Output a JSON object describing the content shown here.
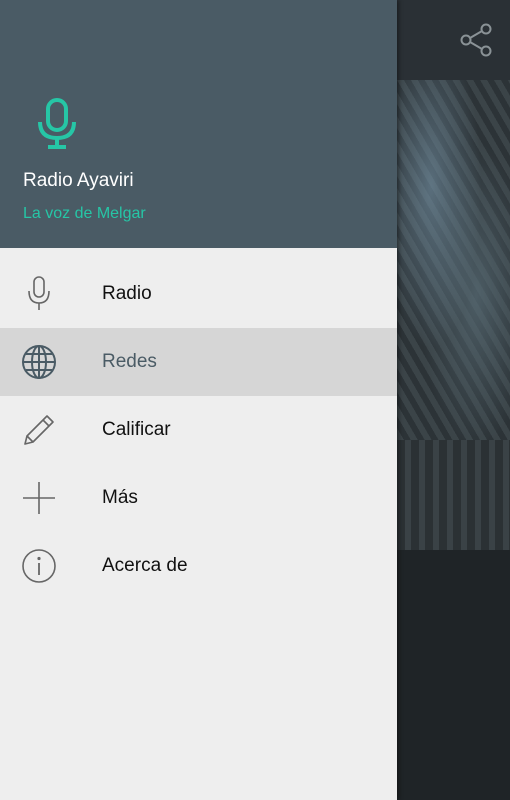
{
  "header": {
    "title": "Radio Ayaviri",
    "subtitle": "La voz de Melgar",
    "icon": "microphone-icon",
    "background_color": "#4a5b65",
    "accent_color": "#26c6a6"
  },
  "menu": {
    "items": [
      {
        "label": "Radio",
        "icon": "microphone-icon",
        "active": false
      },
      {
        "label": "Redes",
        "icon": "globe-icon",
        "active": true
      },
      {
        "label": "Calificar",
        "icon": "pencil-icon",
        "active": false
      },
      {
        "label": "Más",
        "icon": "plus-icon",
        "active": false
      },
      {
        "label": "Acerca de",
        "icon": "info-icon",
        "active": false
      }
    ]
  },
  "toolbar": {
    "share_icon": "share-icon"
  }
}
